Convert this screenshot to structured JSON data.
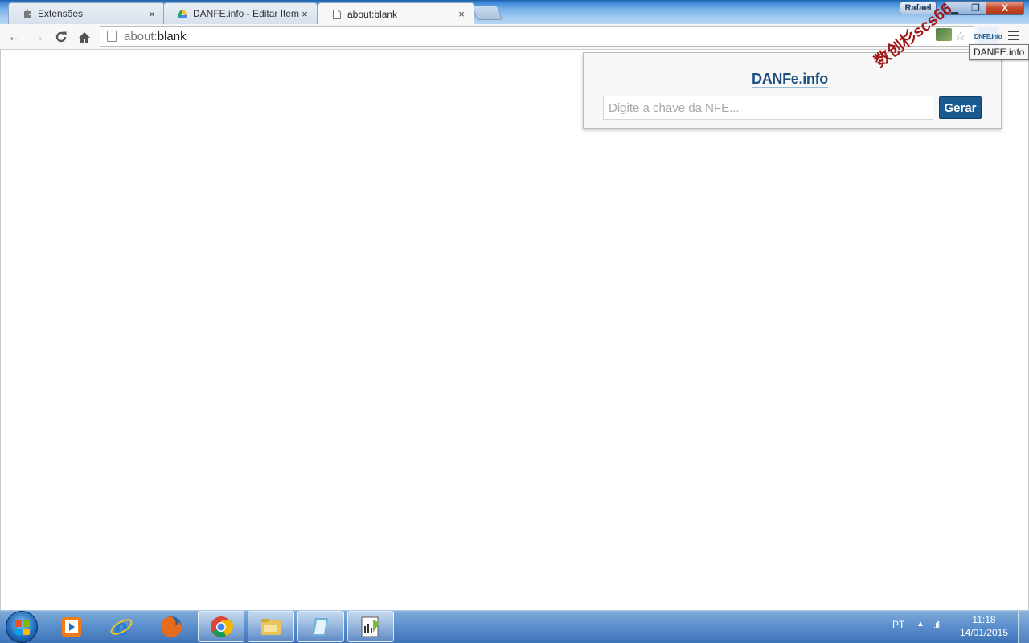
{
  "tabs": [
    {
      "title": "Extensões",
      "icon": "puzzle-icon",
      "close": "×"
    },
    {
      "title": "DANFE.info - Editar Item",
      "icon": "drive-icon",
      "close": "×"
    },
    {
      "title": "about:blank",
      "icon": "page-icon",
      "close": "×",
      "active": true
    }
  ],
  "window": {
    "user": "Rafael",
    "minimize": "▁",
    "maximize": "❐",
    "close": "X"
  },
  "toolbar": {
    "back": "←",
    "forward": "→",
    "reload": "C",
    "home": "⌂",
    "url_scheme": "about:",
    "url_rest": "blank",
    "star": "☆",
    "danfe_ext_label": "DNFE.info"
  },
  "tooltip": "DANFE.info",
  "popup": {
    "logo": "DANFe.info",
    "placeholder": "Digite a chave da NFE...",
    "button": "Gerar"
  },
  "watermark": "数创杉scs66",
  "taskbar": {
    "apps": [
      {
        "name": "media-player-icon",
        "color": "#f07c1a"
      },
      {
        "name": "internet-explorer-icon",
        "color": "#1e7fd8"
      },
      {
        "name": "firefox-icon",
        "color": "#e56b1f"
      },
      {
        "name": "chrome-icon",
        "color": "#3aa757",
        "open": true
      },
      {
        "name": "file-explorer-icon",
        "color": "#e8c45a",
        "open": true
      },
      {
        "name": "notepad-app-icon",
        "color": "#6fb0d8",
        "open": true
      },
      {
        "name": "sheet-app-icon",
        "color": "#7dbb3e",
        "open": true
      }
    ],
    "language": "PT",
    "tray_arrow": "▲",
    "signal": ".ıll",
    "time": "11:18",
    "date": "14/01/2015"
  }
}
